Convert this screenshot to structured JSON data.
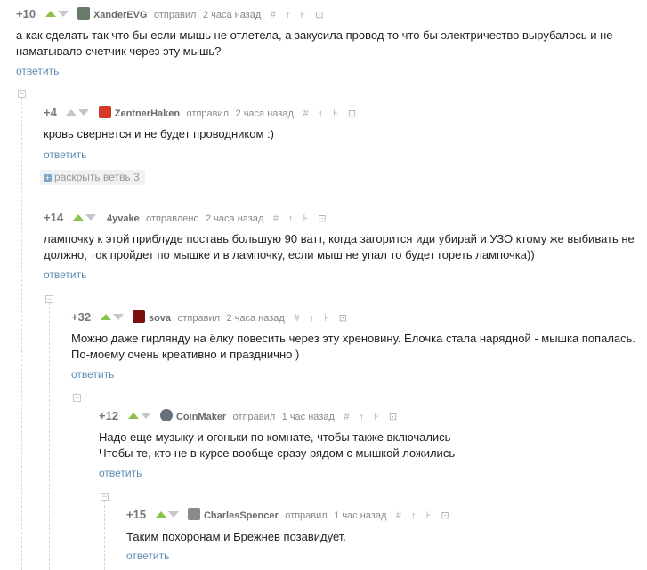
{
  "labels": {
    "reply": "ответить",
    "tools": "# ↑ ⊦ ⊡"
  },
  "branch": {
    "label": "раскрыть ветвь 3"
  },
  "comments": [
    {
      "rating": "+10",
      "user": "XanderEVG",
      "action": "отправил",
      "time": "2 часа назад",
      "text": "а как сделать так что бы если мышь не отлетела, а закусила провод то что бы электричество вырубалось и не наматывало счетчик через эту мышь?",
      "avatar_color": "#6a7a6a"
    },
    {
      "rating": "+4",
      "user": "ZentnerHaken",
      "action": "отправил",
      "time": "2 часа назад",
      "text": "кровь свернется и не будет проводником :)",
      "avatar_color": "#d63a2a"
    },
    {
      "rating": "+14",
      "user": "4yvake",
      "action": "отправлено",
      "time": "2 часа назад",
      "text": "лампочку к этой приблуде поставь большую 90 ватт, когда загорится иди убирай и УЗО ктому же выбивать не должно, ток пройдет по мышке и в лампочку, если мыш не упал то будет гореть лампочка))",
      "avatar_color": ""
    },
    {
      "rating": "+32",
      "user": "sova",
      "action": "отправил",
      "time": "2 часа назад",
      "text": "Можно даже гирлянду на ёлку повесить через эту хреновину. Ёлочка стала нарядной - мышка попалась. По-моему очень креативно и празднично )",
      "avatar_color": "#7a1010"
    },
    {
      "rating": "+12",
      "user": "CoinMaker",
      "action": "отправил",
      "time": "1 час назад",
      "text_line1": "Надо еще музыку и огоньки по комнате, чтобы также включались",
      "text_line2": "Чтобы те, кто не в курсе вообще сразу рядом с мышкой ложились",
      "avatar_color": "#66707a"
    },
    {
      "rating": "+15",
      "user": "CharlesSpencer",
      "action": "отправил",
      "time": "1 час назад",
      "text": "Таким похоронам и Брежнев позавидует.",
      "avatar_color": "#8a8a8a"
    }
  ]
}
